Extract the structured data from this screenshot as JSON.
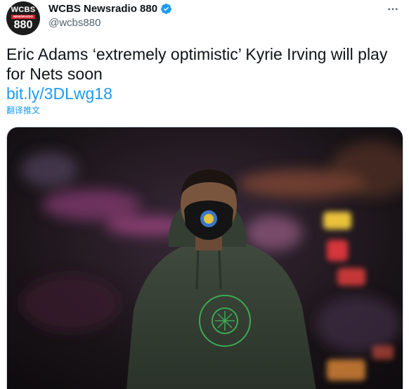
{
  "author": {
    "display_name": "WCBS Newsradio 880",
    "handle": "@wcbs880",
    "avatar": {
      "line1": "WCBS",
      "line2": "NEWSRADIO",
      "line3": "880"
    }
  },
  "tweet": {
    "text": "Eric Adams ‘extremely optimistic’ Kyrie Irving will play for Nets soon",
    "link": "bit.ly/3DLwg18",
    "translate_label": "翻译推文"
  },
  "icons": {
    "verified": "verified-badge-icon",
    "more": "more-options-icon"
  },
  "colors": {
    "link": "#1d9bf0",
    "verified": "#1d9bf0",
    "text": "#0f1419",
    "secondary": "#536471"
  }
}
